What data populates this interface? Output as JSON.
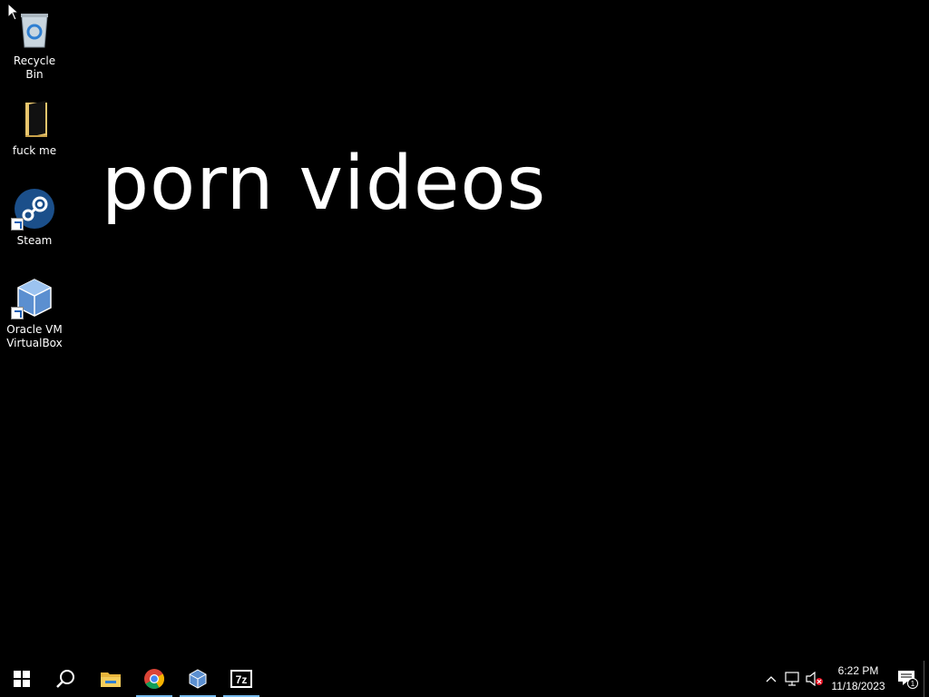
{
  "desktop": {
    "icons": [
      {
        "label": "Recycle Bin",
        "icon": "recycle-bin-icon"
      },
      {
        "label": "fuck me",
        "icon": "folder-icon"
      },
      {
        "label": "Steam",
        "icon": "steam-icon"
      },
      {
        "label": "Oracle VM VirtualBox",
        "icon": "virtualbox-icon"
      }
    ],
    "wallpaper_text": "porn videos"
  },
  "taskbar": {
    "pinned": [
      {
        "name": "start",
        "icon": "windows-start-icon"
      },
      {
        "name": "search",
        "icon": "search-icon"
      },
      {
        "name": "file-explorer",
        "icon": "folder-icon"
      },
      {
        "name": "chrome",
        "icon": "chrome-icon"
      },
      {
        "name": "virtualbox",
        "icon": "virtualbox-icon"
      },
      {
        "name": "7zip",
        "icon": "7zip-icon"
      }
    ],
    "tray": {
      "time": "6:22 PM",
      "date": "11/18/2023",
      "notification_count": "1"
    }
  },
  "colors": {
    "background": "#000000",
    "text": "#ffffff",
    "running_indicator": "#76b9ed"
  }
}
